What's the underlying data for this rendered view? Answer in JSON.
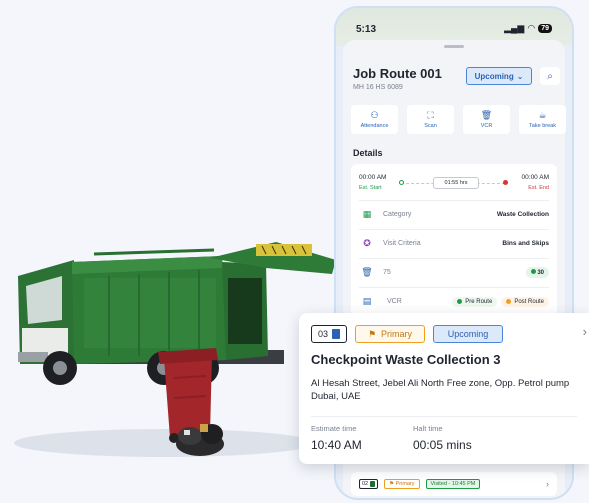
{
  "status_bar": {
    "time": "5:13",
    "battery": "79"
  },
  "route": {
    "title": "Job Route 001",
    "plate": "MH 16 HS 6089",
    "status": "Upcoming"
  },
  "actions": [
    {
      "label": "Attendance",
      "icon": "attendance-icon"
    },
    {
      "label": "Scan",
      "icon": "scan-icon"
    },
    {
      "label": "VCR",
      "icon": "vcr-icon"
    },
    {
      "label": "Take break",
      "icon": "break-icon"
    }
  ],
  "details": {
    "heading": "Details",
    "start_time": "00:00 AM",
    "start_label": "Est. Start",
    "end_time": "00:00 AM",
    "end_label": "Est. End",
    "duration": "01:55 hrs",
    "category_label": "Category",
    "category_value": "Waste Collection",
    "visit_label": "Visit Criteria",
    "visit_value": "Bins and Skips",
    "bins_total": "75",
    "bins_done": "30",
    "vcr_label": "VCR",
    "vcr_pre": "Pre Route",
    "vcr_post": "Post Route"
  },
  "checkpoint": {
    "sequence": "03",
    "priority": "Primary",
    "status": "Upcoming",
    "title": "Checkpoint Waste Collection 3",
    "address": "Al Hesah Street, Jebel Ali North Free zone,  Opp. Petrol pump Dubai, UAE",
    "estimate_label": "Estimate time",
    "estimate_value": "10:40 AM",
    "halt_label": "Halt time",
    "halt_value": "00:05 mins"
  },
  "next_checkpoint": {
    "sequence": "02",
    "priority": "Primary",
    "status": "Visited - 10:45 PM"
  },
  "colors": {
    "accent_blue": "#2b62b4",
    "truck_green": "#2e7a37",
    "bin_red": "#a3262b",
    "primary_orange": "#f0a020",
    "success_green": "#1f9a46"
  }
}
